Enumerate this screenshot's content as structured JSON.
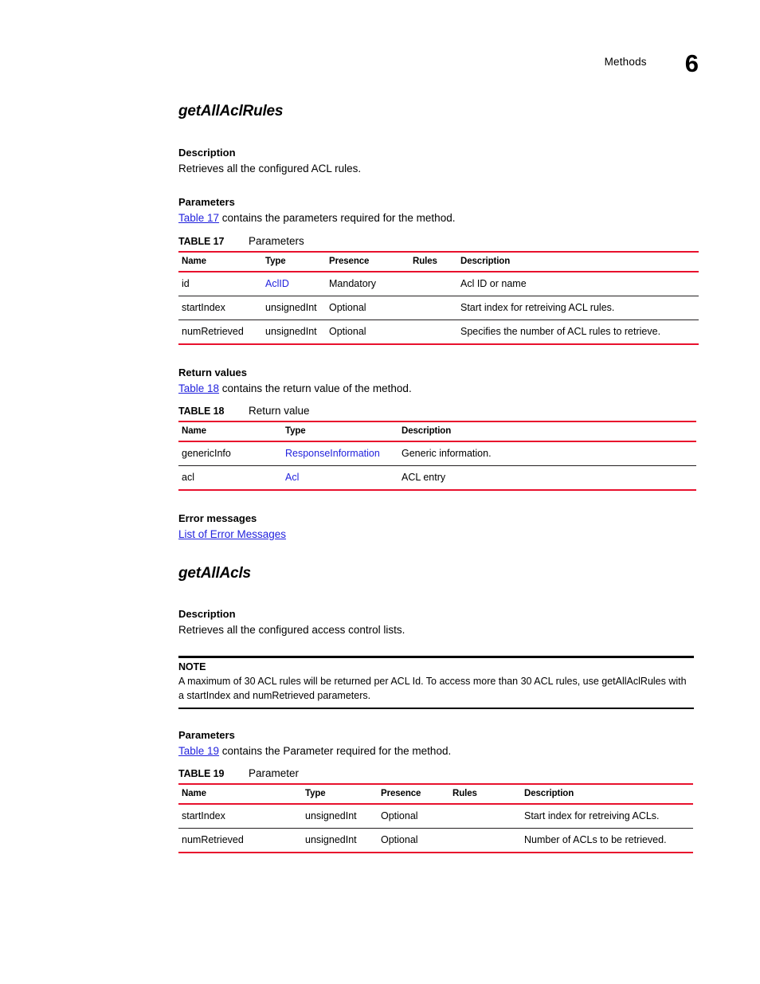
{
  "header": {
    "title": "Methods",
    "chapter": "6"
  },
  "methods": [
    {
      "name": "getAllAclRules",
      "description_heading": "Description",
      "description_text": "Retrieves all the configured ACL rules.",
      "parameters_heading": "Parameters",
      "parameters_intro_link": "Table 17",
      "parameters_intro_rest": " contains the parameters required for the method.",
      "parameters_table": {
        "caption_number": "TABLE 17",
        "caption_title": "Parameters",
        "columns": [
          "Name",
          "Type",
          "Presence",
          "Rules",
          "Description"
        ],
        "rows": [
          {
            "name": "id",
            "type": "AclID",
            "type_is_link": true,
            "presence": "Mandatory",
            "rules": "",
            "description": "Acl ID or name"
          },
          {
            "name": "startIndex",
            "type": "unsignedInt",
            "type_is_link": false,
            "presence": "Optional",
            "rules": "",
            "description": "Start index for retreiving ACL rules."
          },
          {
            "name": "numRetrieved",
            "type": "unsignedInt",
            "type_is_link": false,
            "presence": "Optional",
            "rules": "",
            "description": "Specifies the number of ACL rules to retrieve."
          }
        ]
      },
      "return_heading": "Return values",
      "return_intro_link": "Table 18",
      "return_intro_rest": " contains the return value of the method.",
      "return_table": {
        "caption_number": "TABLE 18",
        "caption_title": "Return value",
        "columns": [
          "Name",
          "Type",
          "Description"
        ],
        "rows": [
          {
            "name": "genericInfo",
            "type": "ResponseInformation",
            "type_is_link": true,
            "description": "Generic information."
          },
          {
            "name": "acl",
            "type": "Acl",
            "type_is_link": true,
            "description": "ACL entry"
          }
        ]
      },
      "error_heading": "Error messages",
      "error_link": "List of Error Messages"
    },
    {
      "name": "getAllAcls",
      "description_heading": "Description",
      "description_text": "Retrieves all the configured access control lists.",
      "note": {
        "label": "NOTE",
        "text": "A maximum of 30 ACL rules will be returned per ACL Id.  To access more than 30 ACL rules, use getAllAclRules with a startIndex and numRetrieved parameters."
      },
      "parameters_heading": "Parameters",
      "parameters_intro_link": "Table 19",
      "parameters_intro_rest": " contains the Parameter required for the method.",
      "parameters_table": {
        "caption_number": "TABLE 19",
        "caption_title": "Parameter",
        "columns": [
          "Name",
          "Type",
          "Presence",
          "Rules",
          "Description"
        ],
        "rows": [
          {
            "name": "startIndex",
            "type": "unsignedInt",
            "type_is_link": false,
            "presence": "Optional",
            "rules": "",
            "description": "Start index for retreiving ACLs."
          },
          {
            "name": "numRetrieved",
            "type": "unsignedInt",
            "type_is_link": false,
            "presence": "Optional",
            "rules": "",
            "description": "Number of ACLs to be retrieved."
          }
        ]
      }
    }
  ],
  "colors": {
    "rule_red": "#e8112d",
    "link_blue": "#2222dd",
    "text_black": "#000000"
  }
}
